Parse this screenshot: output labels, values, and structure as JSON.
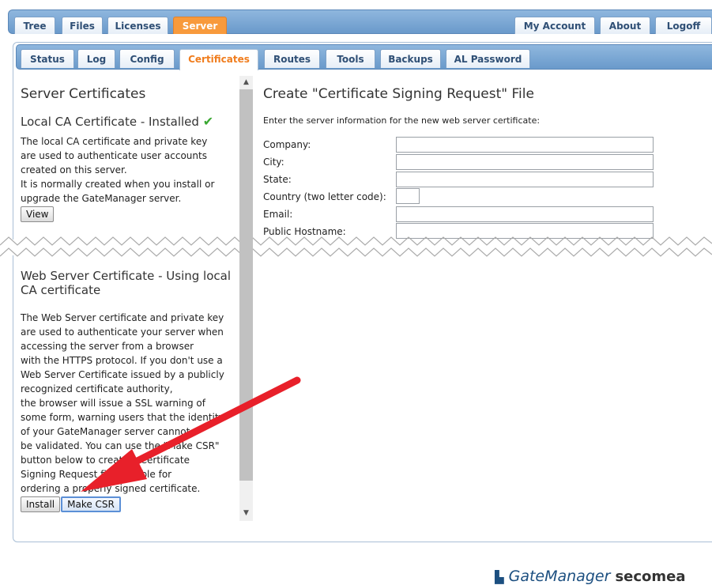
{
  "top_tabs": {
    "left": [
      "Tree",
      "Files",
      "Licenses",
      "Server"
    ],
    "active": "Server",
    "right": [
      "My Account",
      "About",
      "Logoff"
    ]
  },
  "sub_tabs": {
    "items": [
      "Status",
      "Log",
      "Config",
      "Certificates",
      "Routes",
      "Tools",
      "Backups",
      "AL Password"
    ],
    "active": "Certificates"
  },
  "left_panel": {
    "title": "Server Certificates",
    "local_ca": {
      "heading": "Local CA Certificate - Installed",
      "status_icon": "checkmark",
      "description": [
        "The local CA certificate and private key",
        "are used to authenticate user accounts",
        "created on this server.",
        "It is normally created when you install or",
        "upgrade the GateManager server."
      ],
      "view_button": "View"
    },
    "web_cert": {
      "heading": "Web Server Certificate - Using local CA certificate",
      "description": [
        "The Web Server certificate and private key",
        "are used to authenticate your server when",
        "accessing the server from a browser",
        "with the HTTPS protocol. If you don't use a",
        "Web Server Certificate issued by a publicly",
        "recognized certificate authority,",
        "the browser will issue a SSL warning of",
        "some form, warning users that the identity",
        "of your GateManager server cannot",
        "be validated. You can use the \"Make CSR\"",
        "button below to create a Certificate",
        "Signing Request file suitable for",
        "ordering a properly signed certificate."
      ],
      "install_button": "Install",
      "make_csr_button": "Make CSR"
    }
  },
  "right_panel": {
    "title": "Create \"Certificate Signing Request\" File",
    "intro": "Enter the server information for the new web server certificate:",
    "fields": {
      "company": {
        "label": "Company:",
        "value": ""
      },
      "city": {
        "label": "City:",
        "value": ""
      },
      "state": {
        "label": "State:",
        "value": ""
      },
      "country": {
        "label": "Country (two letter code):",
        "value": ""
      },
      "email": {
        "label": "Email:",
        "value": ""
      },
      "hostname": {
        "label": "Public Hostname:",
        "value": ""
      }
    }
  },
  "footer": {
    "brand": "GateManager",
    "vendor": "secomea"
  },
  "colors": {
    "active_tab": "#f89a3c",
    "tab_bar": "#7aa6d4",
    "annotation_arrow": "#e8202a",
    "check": "#3aa832"
  }
}
